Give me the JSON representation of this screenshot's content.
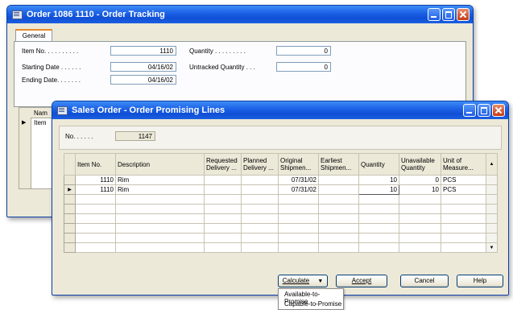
{
  "back_window": {
    "title": "Order 1086 1110 - Order Tracking",
    "tab": "General",
    "item_no_label": "Item No. . . . . . . . . .",
    "item_no_value": "1110",
    "starting_date_label": "Starting Date . . . . . .",
    "starting_date_value": "04/16/02",
    "ending_date_label": "Ending Date. . . . . . .",
    "ending_date_value": "04/16/02",
    "quantity_label": "Quantity . . . . . . . . .",
    "quantity_value": "0",
    "untracked_label": "Untracked Quantity . . .",
    "untracked_value": "0",
    "grid_header": "Nam",
    "grid_first": "Item"
  },
  "front_window": {
    "title": "Sales Order - Order Promising Lines",
    "no_label": "No. . . . . .",
    "no_value": "1147",
    "columns": [
      "Item No.",
      "Description",
      "Requested Delivery ...",
      "Planned Delivery ...",
      "Original Shipmen...",
      "Earliest Shipmen...",
      "Quantity",
      "Unavailable Quantity",
      "Unit of Measure..."
    ],
    "rows": [
      {
        "item_no": "1110",
        "description": "Rim",
        "requested": "",
        "planned": "",
        "original": "07/31/02",
        "earliest": "",
        "quantity": "10",
        "unavailable": "0",
        "uom": "PCS"
      },
      {
        "item_no": "1110",
        "description": "Rim",
        "requested": "",
        "planned": "",
        "original": "07/31/02",
        "earliest": "",
        "quantity": "10",
        "unavailable": "10",
        "uom": "PCS"
      }
    ],
    "buttons": {
      "calculate": "Calculate",
      "accept": "Accept",
      "cancel": "Cancel",
      "help": "Help"
    },
    "dropdown_items": [
      "Available-to-Promise",
      "Capable-to-Promise"
    ]
  },
  "colors": {
    "titlebar": "#1a5fe4",
    "window_bg": "#ece9d8",
    "close_button": "#c43b14"
  }
}
